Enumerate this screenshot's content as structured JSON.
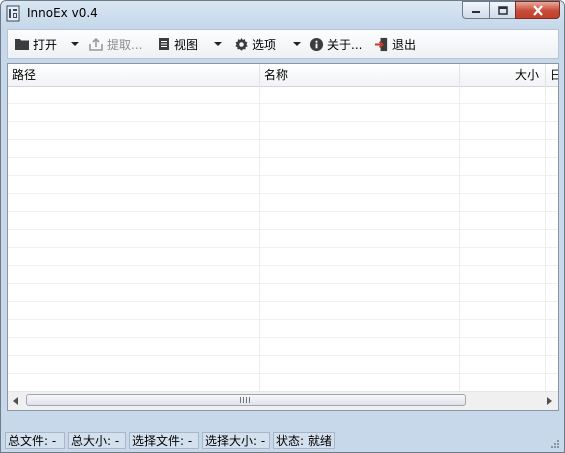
{
  "window": {
    "title": "InnoEx v0.4"
  },
  "toolbar": {
    "open_label": "打开",
    "extract_label": "提取...",
    "view_label": "视图",
    "options_label": "选项",
    "about_label": "关于...",
    "exit_label": "退出"
  },
  "list": {
    "columns": [
      "路径",
      "名称",
      "大小",
      "日"
    ]
  },
  "statusbar": {
    "total_files": "总文件: -",
    "total_size": "总大小: -",
    "selected_files": "选择文件: -",
    "selected_size": "选择大小: -",
    "status": "状态: 就绪"
  },
  "icons": {
    "app": "app-icon",
    "minimize": "minimize-icon",
    "maximize": "maximize-icon",
    "close": "close-icon"
  },
  "colors": {
    "close_button": "#c74a38",
    "title_bar": "#c6d8ea"
  }
}
